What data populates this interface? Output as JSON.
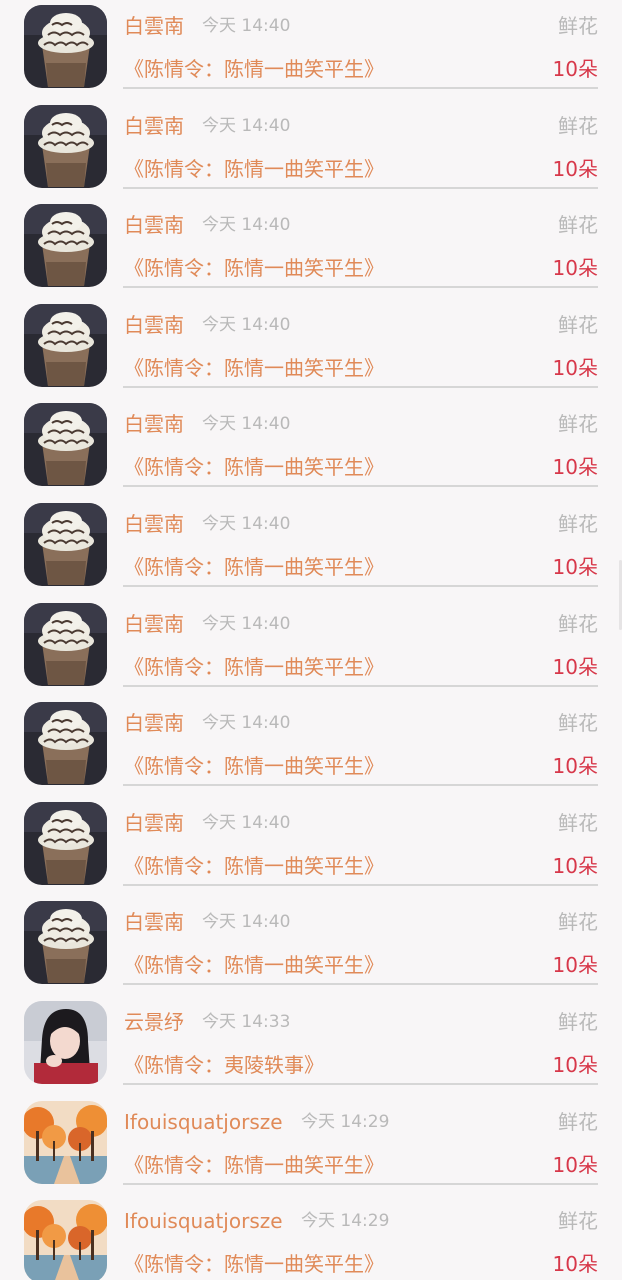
{
  "gifts": [
    {
      "avatar": "frappuccino-avatar",
      "name": "白雲南",
      "time": "今天 14:40",
      "type": "鲜花",
      "book": "《陈情令：陈情一曲笑平生》",
      "count": "10朵"
    },
    {
      "avatar": "frappuccino-avatar",
      "name": "白雲南",
      "time": "今天 14:40",
      "type": "鲜花",
      "book": "《陈情令：陈情一曲笑平生》",
      "count": "10朵"
    },
    {
      "avatar": "frappuccino-avatar",
      "name": "白雲南",
      "time": "今天 14:40",
      "type": "鲜花",
      "book": "《陈情令：陈情一曲笑平生》",
      "count": "10朵"
    },
    {
      "avatar": "frappuccino-avatar",
      "name": "白雲南",
      "time": "今天 14:40",
      "type": "鲜花",
      "book": "《陈情令：陈情一曲笑平生》",
      "count": "10朵"
    },
    {
      "avatar": "frappuccino-avatar",
      "name": "白雲南",
      "time": "今天 14:40",
      "type": "鲜花",
      "book": "《陈情令：陈情一曲笑平生》",
      "count": "10朵"
    },
    {
      "avatar": "frappuccino-avatar",
      "name": "白雲南",
      "time": "今天 14:40",
      "type": "鲜花",
      "book": "《陈情令：陈情一曲笑平生》",
      "count": "10朵"
    },
    {
      "avatar": "frappuccino-avatar",
      "name": "白雲南",
      "time": "今天 14:40",
      "type": "鲜花",
      "book": "《陈情令：陈情一曲笑平生》",
      "count": "10朵"
    },
    {
      "avatar": "frappuccino-avatar",
      "name": "白雲南",
      "time": "今天 14:40",
      "type": "鲜花",
      "book": "《陈情令：陈情一曲笑平生》",
      "count": "10朵"
    },
    {
      "avatar": "frappuccino-avatar",
      "name": "白雲南",
      "time": "今天 14:40",
      "type": "鲜花",
      "book": "《陈情令：陈情一曲笑平生》",
      "count": "10朵"
    },
    {
      "avatar": "frappuccino-avatar",
      "name": "白雲南",
      "time": "今天 14:40",
      "type": "鲜花",
      "book": "《陈情令：陈情一曲笑平生》",
      "count": "10朵"
    },
    {
      "avatar": "girl-avatar",
      "name": "云景纾",
      "time": "今天 14:33",
      "type": "鲜花",
      "book": "《陈情令：夷陵轶事》",
      "count": "10朵"
    },
    {
      "avatar": "autumn-trees-avatar",
      "name": "Ifouisquatjorsze",
      "time": "今天 14:29",
      "type": "鲜花",
      "book": "《陈情令：陈情一曲笑平生》",
      "count": "10朵"
    },
    {
      "avatar": "autumn-trees-avatar",
      "name": "Ifouisquatjorsze",
      "time": "今天 14:29",
      "type": "鲜花",
      "book": "《陈情令：陈情一曲笑平生》",
      "count": "10朵"
    }
  ]
}
